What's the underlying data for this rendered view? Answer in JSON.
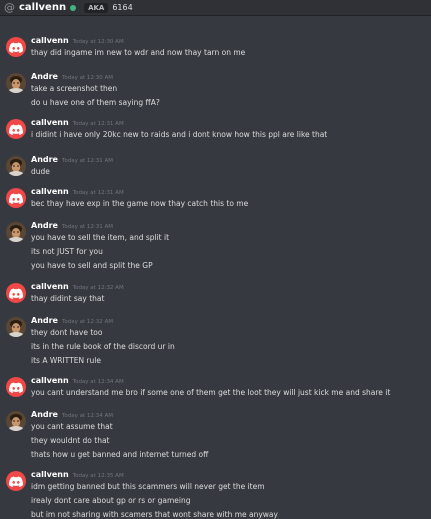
{
  "header": {
    "at_symbol": "@",
    "username": "callvenn",
    "aka_label": "AKA",
    "aka_value": "6164"
  },
  "messages": [
    {
      "author": "callvenn",
      "avatar": "discord-logo-icon",
      "timestamp": "Today at 12:30 AM",
      "lines": [
        "thay did ingame im new to wdr and now thay tarn on me"
      ]
    },
    {
      "author": "Andre",
      "avatar": "user-avatar",
      "timestamp": "Today at 12:30 AM",
      "lines": [
        "take a screenshot then",
        "do u have one of them saying ffA?"
      ]
    },
    {
      "author": "callvenn",
      "avatar": "discord-logo-icon",
      "timestamp": "Today at 12:31 AM",
      "lines": [
        "i didint i have only 20kc new to raids and i dont know how this ppl are like that"
      ]
    },
    {
      "author": "Andre",
      "avatar": "user-avatar",
      "timestamp": "Today at 12:31 AM",
      "lines": [
        "dude"
      ]
    },
    {
      "author": "callvenn",
      "avatar": "discord-logo-icon",
      "timestamp": "Today at 12:31 AM",
      "lines": [
        "bec thay have exp in the game now thay catch this to me"
      ]
    },
    {
      "author": "Andre",
      "avatar": "user-avatar",
      "timestamp": "Today at 12:31 AM",
      "lines": [
        "you have to sell the item, and split it",
        "its not JUST for you",
        "you have to sell and split the GP"
      ]
    },
    {
      "author": "callvenn",
      "avatar": "discord-logo-icon",
      "timestamp": "Today at 12:32 AM",
      "lines": [
        "thay didint say that"
      ]
    },
    {
      "author": "Andre",
      "avatar": "user-avatar",
      "timestamp": "Today at 12:32 AM",
      "lines": [
        "they dont have too",
        "its in the rule book of the discord ur in",
        "its A WRITTEN rule"
      ]
    },
    {
      "author": "callvenn",
      "avatar": "discord-logo-icon",
      "timestamp": "Today at 12:34 AM",
      "lines": [
        "you cant understand me bro if some one of them get the loot they will just kick me and share it"
      ]
    },
    {
      "author": "Andre",
      "avatar": "user-avatar",
      "timestamp": "Today at 12:34 AM",
      "lines": [
        "you cant assume that",
        "they wouldnt do that",
        "thats how u get banned and internet turned off"
      ]
    },
    {
      "author": "callvenn",
      "avatar": "discord-logo-icon",
      "timestamp": "Today at 12:35 AM",
      "lines": [
        "idm getting banned but this scammers will never get the item",
        "irealy dont care about gp or rs or gameing",
        "but im not sharing with scamers that wont share with me anyway"
      ]
    }
  ],
  "colors": {
    "background": "#36393f",
    "username": "#ffffff",
    "timestamp": "#72767d",
    "discord_red": "#f04747",
    "online": "#43b581"
  }
}
